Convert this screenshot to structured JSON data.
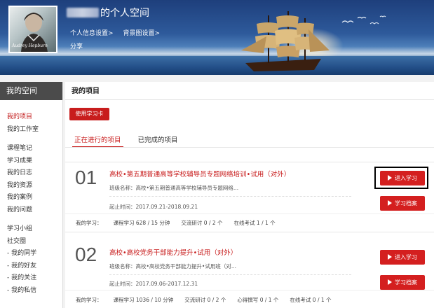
{
  "banner": {
    "title_suffix": "的个人空间",
    "links": [
      "个人信息设置>",
      "背景图设置>"
    ],
    "share": "分享",
    "avatar_caption": "Audrey Hepburn"
  },
  "sidebar": {
    "header": "我的空间",
    "group1": [
      "我的项目",
      "我的工作室"
    ],
    "group2": [
      "课程笔记",
      "学习成果",
      "我的日志",
      "我的资源",
      "我的案例",
      "我的问题"
    ],
    "group3": [
      "学习小组",
      "社交圈",
      "- 我的同学",
      "- 我的好友",
      "- 我的关注",
      "- 我的私信"
    ]
  },
  "main": {
    "title": "我的项目",
    "use_card_button": "使用学习卡",
    "tabs": [
      "正在进行的项目",
      "已完成的项目"
    ]
  },
  "projects": [
    {
      "num": "01",
      "name": "高校•第五期普通高等学校辅导员专题网络培训•试用（对外）",
      "class_name": "班级名称：高校•第五期普通高等学校辅导员专题网络...",
      "time": "起止时间：2017.09.21-2018.09.21",
      "stats": [
        "我的学习：",
        "课程学习  628 / 15 分钟",
        "交流研讨  0 / 2 个",
        "在线考试  1 / 1 个"
      ],
      "btn_enter": "进入学习",
      "btn_archive": "学习档案"
    },
    {
      "num": "02",
      "name": "高校•高校党务干部能力提升•试用（对外）",
      "class_name": "班级名称：高校•高校党务干部能力提升•试用班（对...",
      "time": "起止时间：2017.09.06-2017.12.31",
      "stats": [
        "我的学习：",
        "课程学习  1036 / 10 分钟",
        "交流研讨  0 / 2 个",
        "心得撰写  0 / 1 个",
        "在线考试  0 / 1 个"
      ],
      "btn_enter": "进入学习",
      "btn_archive": "学习档案"
    }
  ],
  "colors": {
    "accent": "#c81d1d",
    "sidebar_header": "#4b4b4b"
  }
}
